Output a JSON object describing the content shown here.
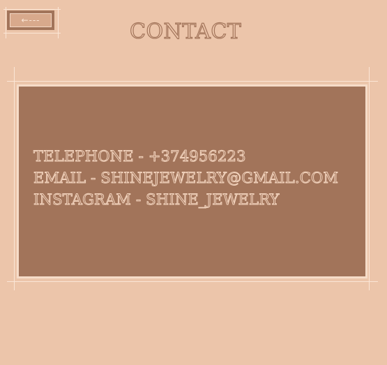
{
  "header": {
    "back_label": "←---",
    "title": "CONTACT"
  },
  "contact": {
    "telephone": "TELEPHONE - +374956223",
    "email": "EMAIL - SHINEJEWELRY@GMAIL.COM",
    "instagram": "INSTAGRAM - SHINE_JEWELRY"
  },
  "colors": {
    "background": "#ecc5aa",
    "card": "#a2745a",
    "frame": "#fbe6d6",
    "text_outline": "#f3d4be"
  }
}
